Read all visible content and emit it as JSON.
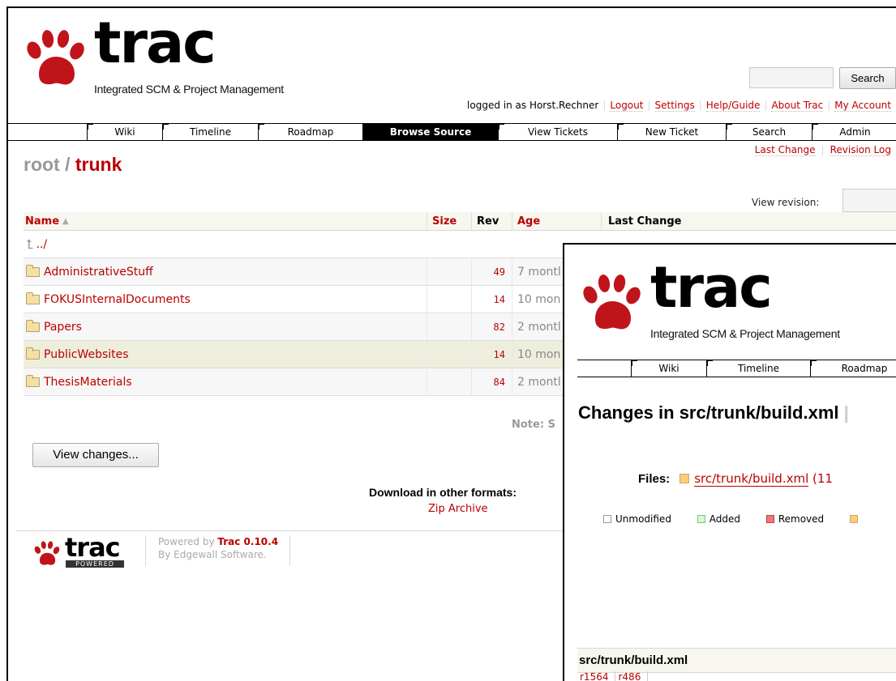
{
  "logo": {
    "word": "trac",
    "subtitle": "Integrated SCM & Project Management"
  },
  "search": {
    "button": "Search"
  },
  "metanav": {
    "logged_in": "logged in as Horst.Rechner",
    "links": [
      "Logout",
      "Settings",
      "Help/Guide",
      "About Trac",
      "My Account"
    ]
  },
  "mainnav": [
    "Wiki",
    "Timeline",
    "Roadmap",
    "Browse Source",
    "View Tickets",
    "New Ticket",
    "Search",
    "Admin"
  ],
  "ctxtnav": [
    "Last Change",
    "Revision Log"
  ],
  "breadcrumb": {
    "root": "root",
    "sep": " / ",
    "current": "trunk"
  },
  "view_revision_label": "View revision:",
  "table": {
    "headers": {
      "name": "Name",
      "size": "Size",
      "rev": "Rev",
      "age": "Age",
      "change": "Last Change"
    },
    "parent": "../",
    "rows": [
      {
        "name": "AdministrativeStuff",
        "rev": "49",
        "age": "7 montl"
      },
      {
        "name": "FOKUSInternalDocuments",
        "rev": "14",
        "age": "10 mon"
      },
      {
        "name": "Papers",
        "rev": "82",
        "age": "2 montl"
      },
      {
        "name": "PublicWebsites",
        "rev": "14",
        "age": "10 mon"
      },
      {
        "name": "ThesisMaterials",
        "rev": "84",
        "age": "2 montl"
      }
    ]
  },
  "note": "Note: S",
  "view_changes": "View changes...",
  "download": {
    "label": "Download in other formats:",
    "zip": "Zip Archive"
  },
  "footer": {
    "badge": "POWERED",
    "line1_prefix": "Powered by ",
    "line1_link": "Trac 0.10.4",
    "line2_prefix": "By ",
    "line2_link": "Edgewall Software",
    "line2_suffix": "."
  },
  "overlay": {
    "nav": [
      "Wiki",
      "Timeline",
      "Roadmap"
    ],
    "title_prefix": "Changes in ",
    "title_path": "src/trunk/build.xml",
    "title_suffix": " |",
    "files_label": "Files:",
    "files_link": "src/trunk/build.xml",
    "files_suffix": " (11",
    "legend": [
      {
        "label": "Unmodified",
        "color": "#ffffff"
      },
      {
        "label": "Added",
        "color": "#ccffcc"
      },
      {
        "label": "Removed",
        "color": "#ee7777"
      },
      {
        "label": "",
        "color": "#ffcc77"
      }
    ],
    "file_header": "src/trunk/build.xml",
    "revs": [
      "r1564",
      "r486"
    ]
  },
  "colors": {
    "link": "#bb0000",
    "active_nav": "#000000",
    "folder": "#f4e0a4"
  }
}
